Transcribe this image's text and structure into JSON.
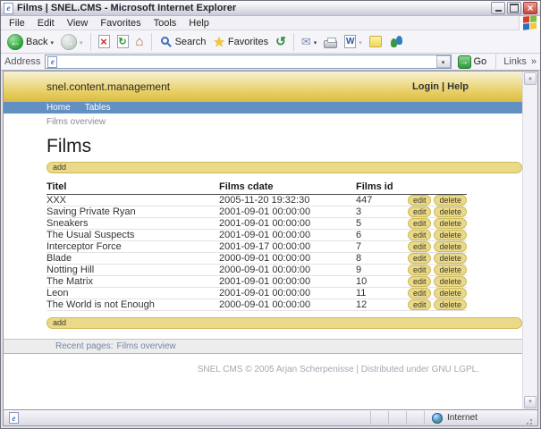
{
  "window": {
    "title": "Films | SNEL.CMS - Microsoft Internet Explorer"
  },
  "menubar": {
    "items": [
      "File",
      "Edit",
      "View",
      "Favorites",
      "Tools",
      "Help"
    ]
  },
  "toolbar": {
    "back_label": "Back",
    "search_label": "Search",
    "favorites_label": "Favorites"
  },
  "addressbar": {
    "label": "Address",
    "value": "",
    "go_label": "Go",
    "links_label": "Links"
  },
  "site": {
    "brand": "snel.content.management",
    "account_links": "Login | Help",
    "nav": [
      "Home",
      "Tables"
    ],
    "breadcrumb": "Films overview"
  },
  "content": {
    "title": "Films",
    "add_label": "add",
    "table": {
      "headers": [
        "Titel",
        "Films cdate",
        "Films id"
      ],
      "edit_label": "edit",
      "delete_label": "delete",
      "rows": [
        {
          "titel": "XXX",
          "cdate": "2005-11-20 19:32:30",
          "id": "447"
        },
        {
          "titel": "Saving Private Ryan",
          "cdate": "2001-09-01 00:00:00",
          "id": "3"
        },
        {
          "titel": "Sneakers",
          "cdate": "2001-09-01 00:00:00",
          "id": "5"
        },
        {
          "titel": "The Usual Suspects",
          "cdate": "2001-09-01 00:00:00",
          "id": "6"
        },
        {
          "titel": "Interceptor Force",
          "cdate": "2001-09-17 00:00:00",
          "id": "7"
        },
        {
          "titel": "Blade",
          "cdate": "2000-09-01 00:00:00",
          "id": "8"
        },
        {
          "titel": "Notting Hill",
          "cdate": "2000-09-01 00:00:00",
          "id": "9"
        },
        {
          "titel": "The Matrix",
          "cdate": "2001-09-01 00:00:00",
          "id": "10"
        },
        {
          "titel": "Leon",
          "cdate": "2001-09-01 00:00:00",
          "id": "11"
        },
        {
          "titel": "The World is not Enough",
          "cdate": "2000-09-01 00:00:00",
          "id": "12"
        }
      ]
    },
    "recent_pages_label": "Recent pages:",
    "recent_pages_link": "Films overview",
    "footer": "SNEL CMS © 2005 Arjan Scherpenisse | Distributed under GNU LGPL."
  },
  "statusbar": {
    "zone": "Internet"
  },
  "colors": {
    "masthead_gold": "#d9bc45",
    "nav_blue": "#6290c3",
    "button_yellow": "#ead989",
    "recent_link_blue": "#7388a6"
  }
}
